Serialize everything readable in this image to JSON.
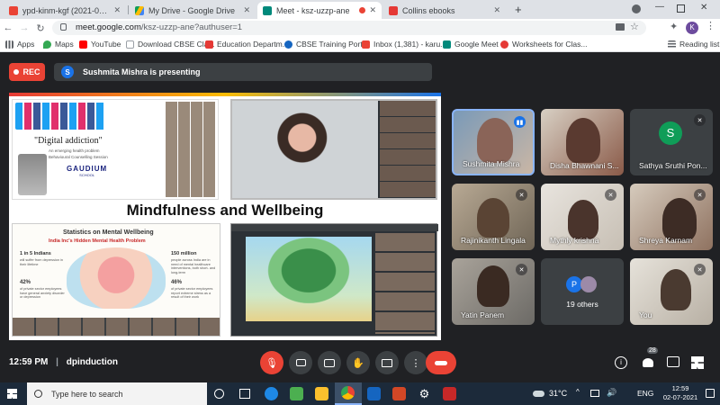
{
  "browser": {
    "tabs": [
      {
        "title": "ypd-kinm-kgf (2021-07-01 at 20",
        "favicon": "gmail-icon",
        "color": "#ea4335",
        "active": false
      },
      {
        "title": "My Drive - Google Drive",
        "favicon": "drive-icon",
        "color": "#fbbc04",
        "active": false
      },
      {
        "title": "Meet - ksz-uzzp-ane",
        "favicon": "meet-icon",
        "color": "#00897b",
        "active": true
      },
      {
        "title": "Collins ebooks",
        "favicon": "collins-icon",
        "color": "#e53935",
        "active": false
      }
    ],
    "new_tab": "+",
    "profile_initial": "K",
    "url_host": "meet.google.com",
    "url_path": "/ksz-uzzp-ane?authuser=1",
    "bookmarks": [
      {
        "label": "Apps",
        "icon": "apps-grid-icon",
        "color": "#5f6368"
      },
      {
        "label": "Maps",
        "icon": "maps-icon",
        "color": "#34a853"
      },
      {
        "label": "YouTube",
        "icon": "youtube-icon",
        "color": "#ff0000"
      },
      {
        "label": "Download CBSE Cla...",
        "icon": "page-icon",
        "color": "#9aa0a6"
      },
      {
        "label": "Education Departm...",
        "icon": "gov-icon",
        "color": "#e53935"
      },
      {
        "label": "CBSE Training Portal",
        "icon": "cbse-icon",
        "color": "#1565c0"
      },
      {
        "label": "Inbox (1,381) - karu...",
        "icon": "gmail-icon",
        "color": "#ea4335"
      },
      {
        "label": "Google Meet",
        "icon": "meet-icon",
        "color": "#00897b"
      },
      {
        "label": "Worksheets for Clas...",
        "icon": "worksheet-icon",
        "color": "#e53935"
      }
    ],
    "reading_list": "Reading list"
  },
  "meet": {
    "rec_label": "REC",
    "presenter_initial": "S",
    "presenting_text": "Sushmita Mishra is presenting",
    "slide": {
      "title": "Mindfulness and Wellbeing",
      "topleft_heading": "\"Digital addiction\"",
      "topleft_sub1": "An emerging health problem",
      "topleft_sub2": "Behavioural Counselling Session",
      "school_name": "GAUDIUM",
      "school_sub": "SCHOOL",
      "stats_heading": "Statistics on Mental Wellbeing",
      "stats_subheading": "India Inc's Hidden Mental Health Problem",
      "stat1_value": "1 in 5 Indians",
      "stat1_text": "will suffer from depression in their lifetime",
      "stat2_value": "150 million",
      "stat2_text": "people across India are in need of mental healthcare interventions, both short- and long-term",
      "stat3_value": "42%",
      "stat3_text": "of private sector employees have general anxiety disorder or depression",
      "stat4_value": "46%",
      "stat4_text": "of private sector employees report extreme stress as a result of their work"
    },
    "participants": [
      {
        "name": "Sushmita Mishra",
        "speaking": true
      },
      {
        "name": "Disha Bhawnani S...",
        "speaking": false
      },
      {
        "name": "Sathya Sruthi Pon...",
        "initial": "S",
        "avatar_color": "#0f9d58",
        "muted": true
      },
      {
        "name": "Rajinikanth Lingala",
        "muted": true
      },
      {
        "name": "Mythly krishna",
        "muted": true
      },
      {
        "name": "Shreya Karnam",
        "muted": true
      },
      {
        "name": "Yatin Panem",
        "muted": true
      },
      {
        "name": "19 others",
        "initial": "P",
        "avatar_color": "#1a73e8"
      },
      {
        "name": "You",
        "muted": true
      }
    ],
    "clock": "12:59 PM",
    "separator": "|",
    "meeting_code": "dpinduction",
    "people_count": "28"
  },
  "taskbar": {
    "search_placeholder": "Type here to search",
    "weather": "31°C",
    "language": "ENG",
    "time": "12:59",
    "date": "02-07-2021"
  }
}
